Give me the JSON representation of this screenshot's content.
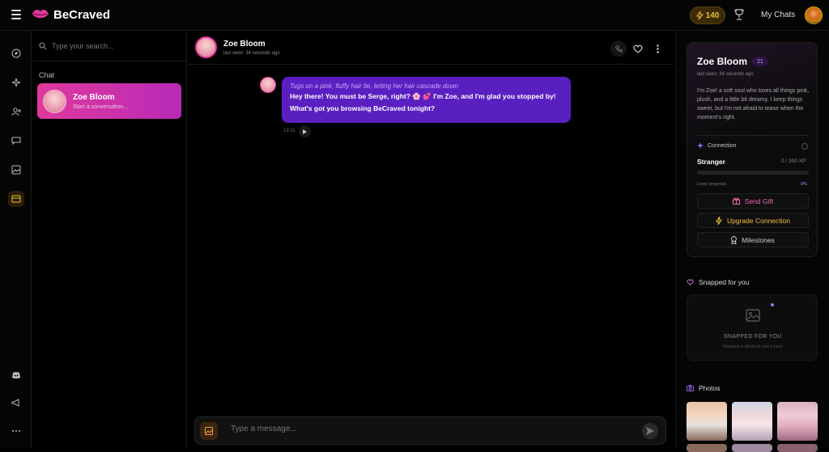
{
  "app": {
    "name": "BeCraved",
    "xp_count": "140",
    "my_chats_label": "My Chats"
  },
  "search": {
    "placeholder": "Type your search..."
  },
  "chat_list": {
    "section_label": "Chat",
    "items": [
      {
        "name": "Zoe Bloom",
        "subtitle": "Start a conversation..."
      }
    ]
  },
  "chat": {
    "name": "Zoe Bloom",
    "last_seen": "last seen: 34 seconds ago",
    "messages": [
      {
        "action": "Tugs on a pink, fluffy hair tie, letting her hair cascade down",
        "line1": "Hey there! You must be Serge, right? 🌸 💕 I'm Zoe, and I'm glad you stopped by!",
        "line2": "What's got you browsing BeCraved tonight?",
        "time": "19:31"
      }
    ],
    "composer_placeholder": "Type a message..."
  },
  "profile": {
    "name": "Zoe Bloom",
    "age": "21",
    "last_seen": "last seen: 34 seconds ago",
    "bio": "I'm Zoe! a soft soul who loves all things pink, plush, and a little bit dreamy. I keep things sweet, but I'm not afraid to tease when the moment's right.",
    "connection_label": "Connection",
    "level_name": "Stranger",
    "xp": "0 / 200 XP",
    "level_progress_label": "Level progress",
    "level_progress_pct": "0%",
    "level_progress_fraction": 0,
    "buttons": {
      "gift": "Send Gift",
      "upgrade": "Upgrade Connection",
      "milestones": "Milestones"
    }
  },
  "snapped": {
    "title": "Snapped for you",
    "box_title": "SNAPPED FOR YOU",
    "box_subtitle": "Request a photo to see it here"
  },
  "photos": {
    "title": "Photos"
  },
  "colors": {
    "accent_pink": "#e0399c",
    "bubble_purple": "#5a1fc0",
    "gold": "#f0c040"
  }
}
